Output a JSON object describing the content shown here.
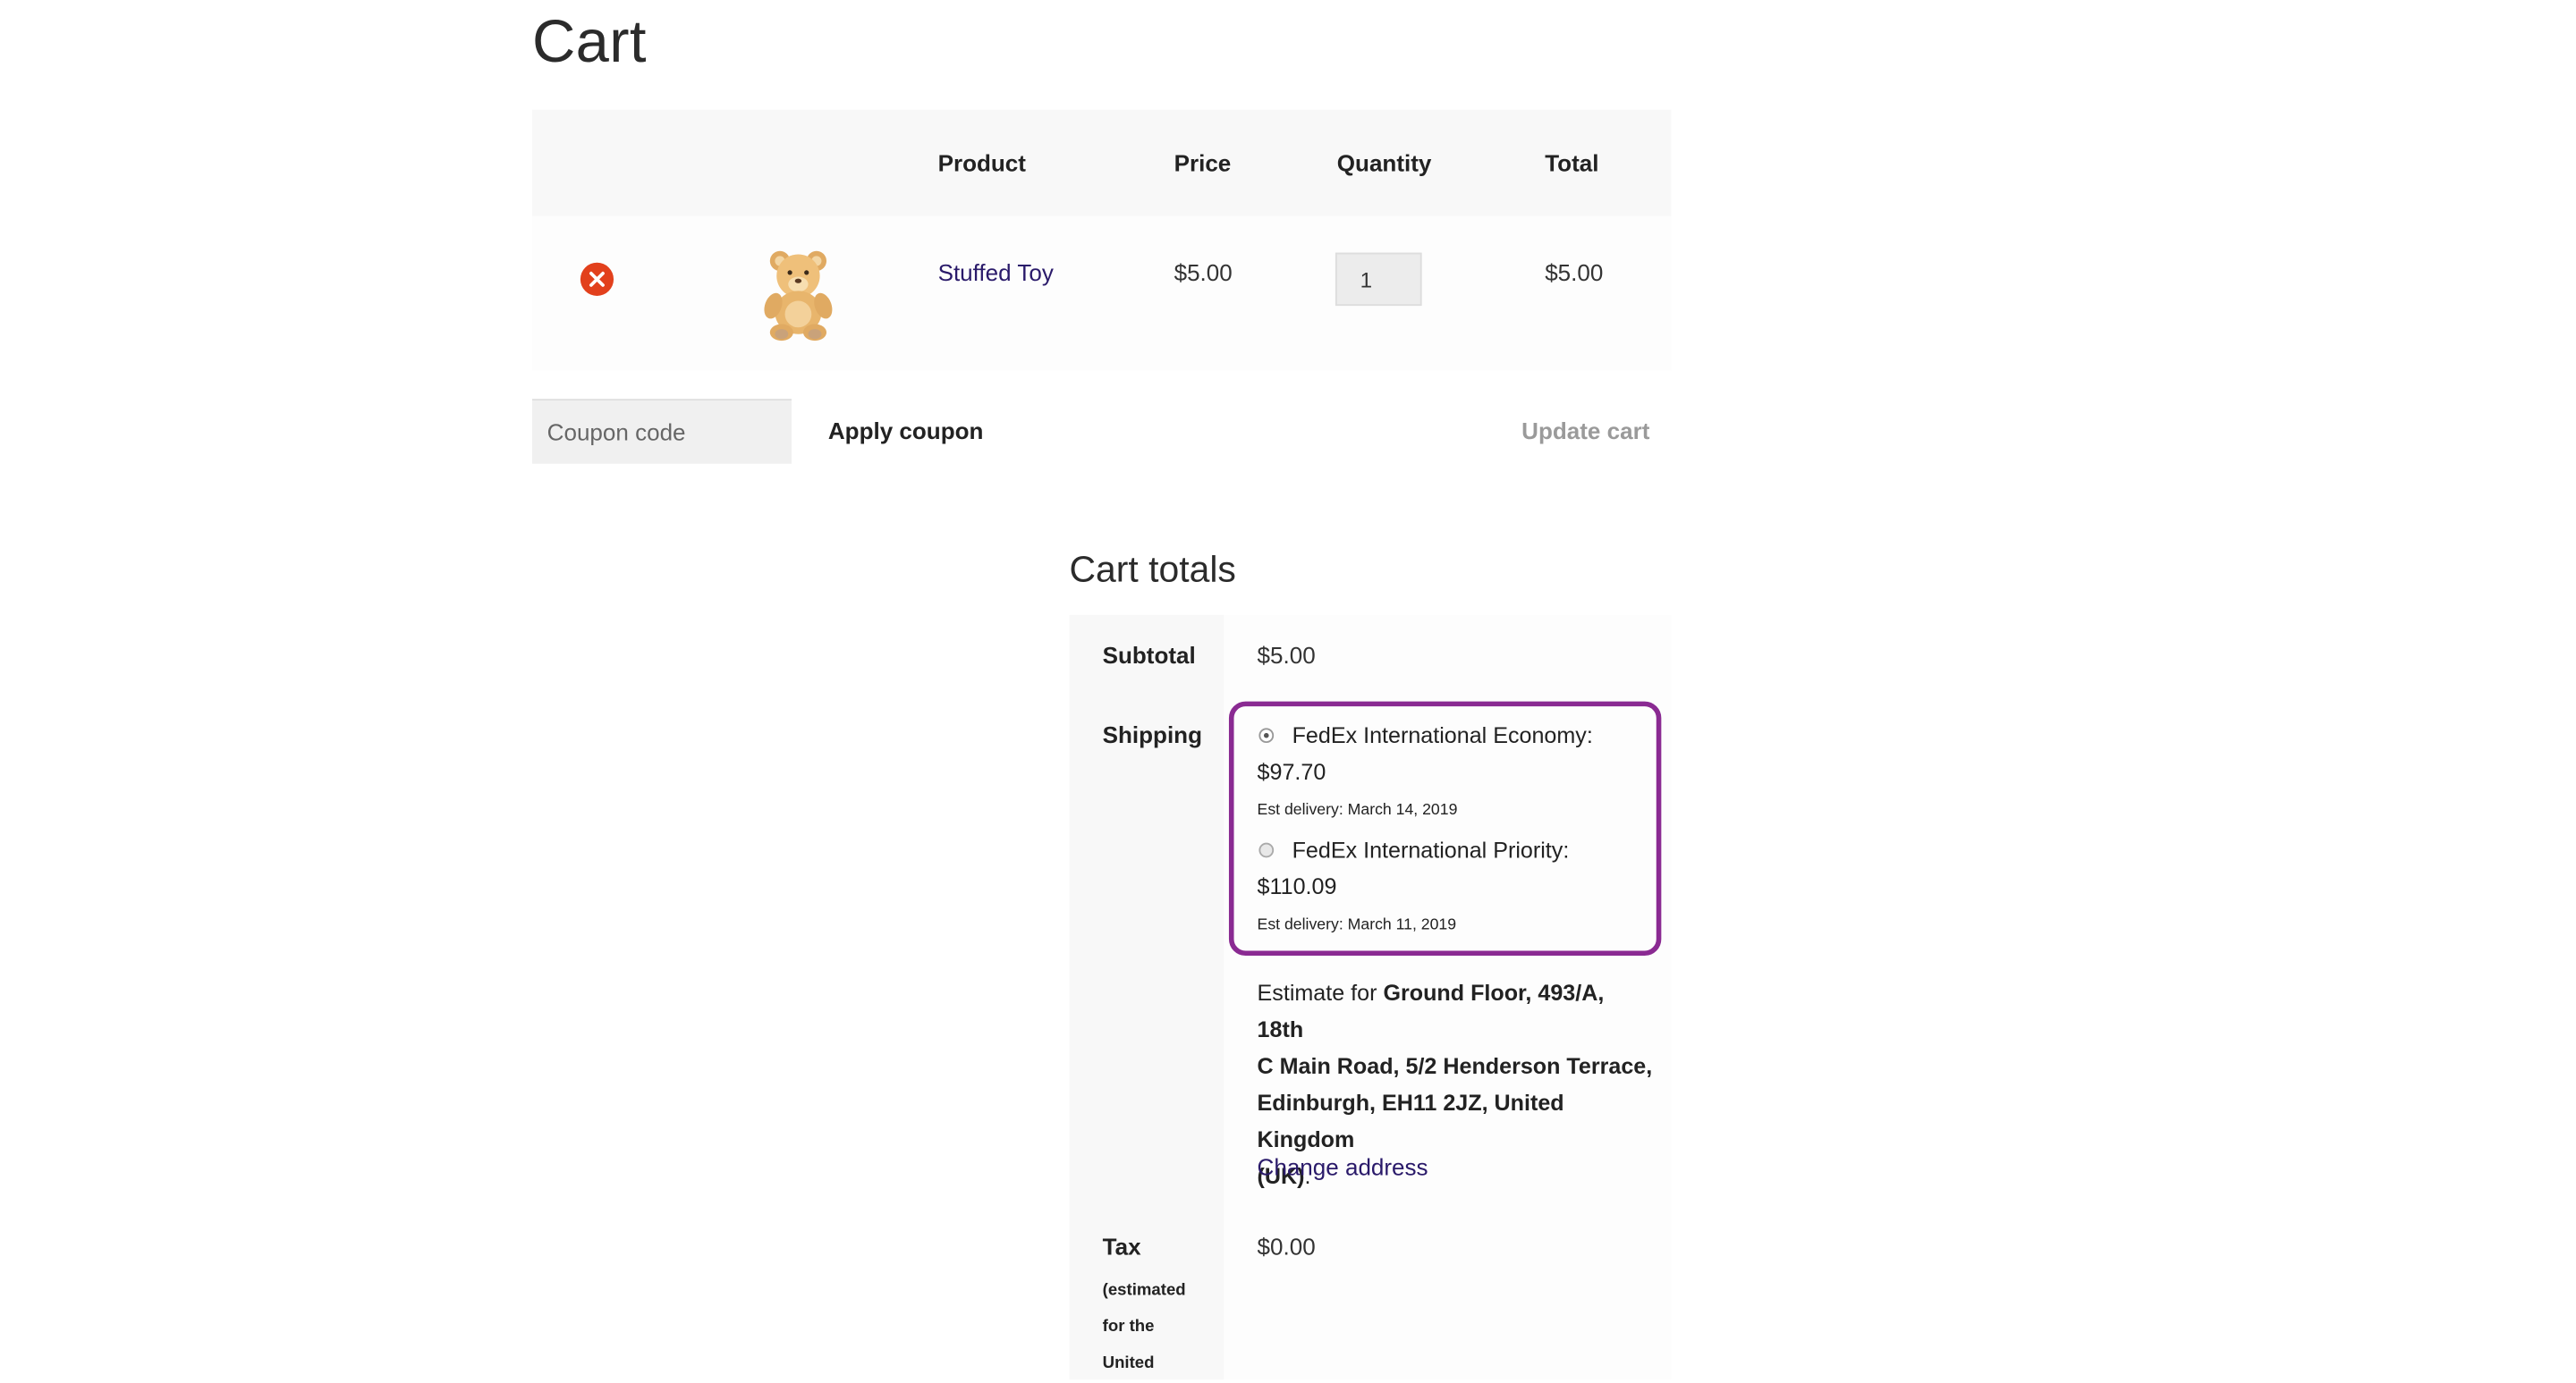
{
  "page": {
    "title": "Cart"
  },
  "cart_table": {
    "headers": {
      "product": "Product",
      "price": "Price",
      "quantity": "Quantity",
      "total": "Total"
    },
    "items": [
      {
        "product": "Stuffed Toy",
        "price": "$5.00",
        "quantity": "1",
        "total": "$5.00",
        "thumbnail_icon": "teddy-bear"
      }
    ]
  },
  "coupon": {
    "placeholder": "Coupon code",
    "apply_label": "Apply coupon"
  },
  "update_label": "Update cart",
  "totals": {
    "title": "Cart totals",
    "subtotal_label": "Subtotal",
    "subtotal_value": "$5.00",
    "shipping_label": "Shipping",
    "shipping_options": [
      {
        "name": "FedEx International Economy:",
        "price": "$97.70",
        "est": "Est delivery: March 14, 2019",
        "selected": true
      },
      {
        "name": "FedEx International Priority:",
        "price": "$110.09",
        "est": "Est delivery: March 11, 2019",
        "selected": false
      }
    ],
    "estimate_prefix": "Estimate for",
    "estimate_address_line1": "Ground Floor, 493/A, 18th",
    "estimate_address_line2": "C Main Road, 5/2 Henderson Terrace,",
    "estimate_address_line3": "Edinburgh, EH11 2JZ, United Kingdom",
    "estimate_address_line4": "(UK)",
    "estimate_suffix": ".",
    "change_address": "Change address",
    "tax_label": "Tax",
    "tax_sub_line1": "(estimated",
    "tax_sub_line2": "for the",
    "tax_sub_line3": "United",
    "tax_value": "$0.00"
  },
  "colors": {
    "link": "#2a1a6a",
    "remove": "#e2401c",
    "highlight_border": "#8a2a92"
  }
}
